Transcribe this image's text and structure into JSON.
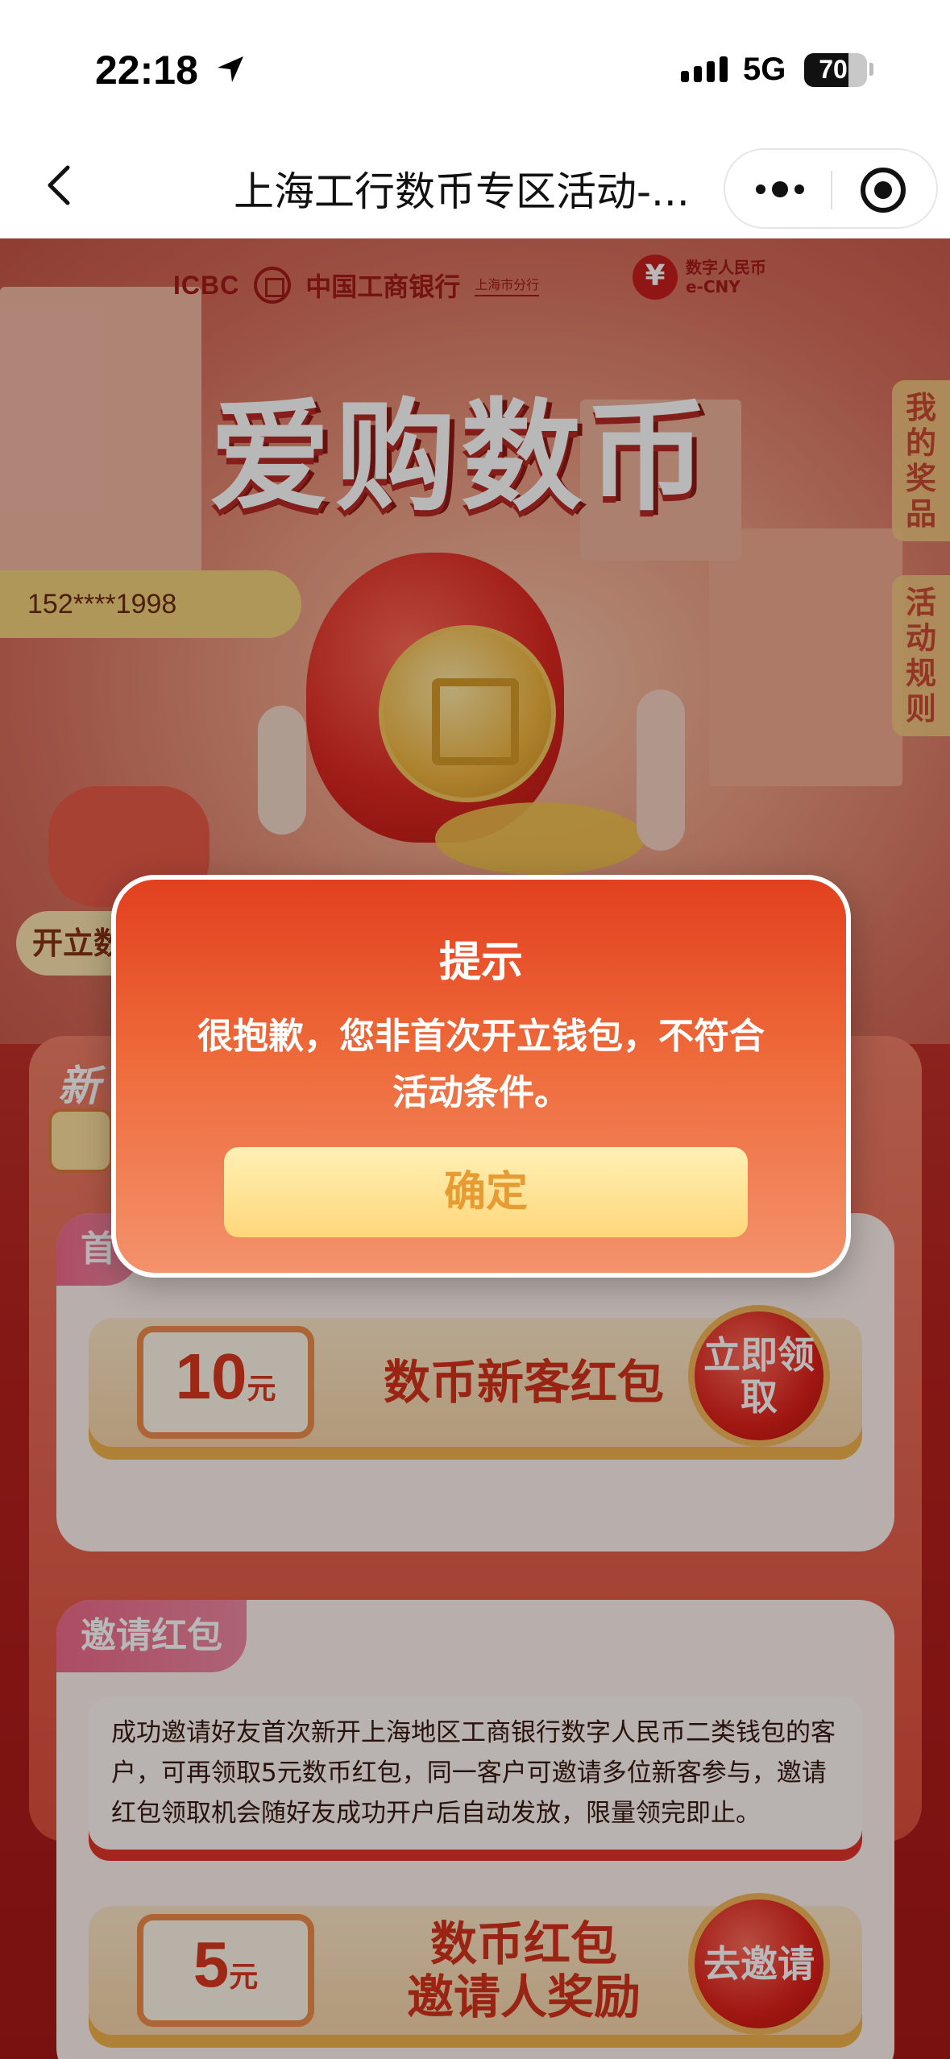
{
  "status_bar": {
    "time": "22:18",
    "network": "5G",
    "battery": "70",
    "battery_fraction": 0.7
  },
  "nav": {
    "title": "上海工行数币专区活动-..."
  },
  "header": {
    "bank_en": "ICBC",
    "bank_cn": "中国工商银行",
    "branch": "上海市分行",
    "ecny_cn": "数字人民币",
    "ecny_en": "e-CNY"
  },
  "hero": {
    "title": "爱购数币",
    "phone": "152****1998",
    "open_wallet": "开立数"
  },
  "side_tabs": {
    "prizes": "我的奖品",
    "rules": "活动规则"
  },
  "new_section": {
    "heading": "新",
    "first_tag": "首",
    "amount": "10",
    "unit": "元",
    "label": "数币新客红包",
    "button": "立即领取"
  },
  "invite_section": {
    "tag": "邀请红包",
    "description": "成功邀请好友首次新开上海地区工商银行数字人民币二类钱包的客户，可再领取5元数币红包，同一客户可邀请多位新客参与，邀请红包领取机会随好友成功开户后自动发放，限量领完即止。",
    "amount": "5",
    "unit": "元",
    "label_line1": "数币红包",
    "label_line2": "邀请人奖励",
    "button": "去邀请"
  },
  "modal": {
    "title": "提示",
    "message": "很抱歉，您非首次开立钱包，不符合活动条件。",
    "confirm": "确定"
  }
}
